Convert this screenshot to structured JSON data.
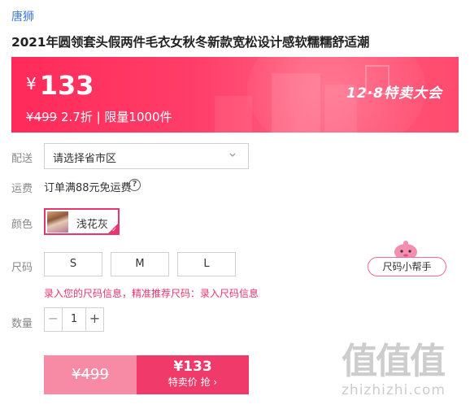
{
  "brand": "唐狮",
  "product_title": "2021年圆领套头假两件毛衣女秋冬新款宽松设计感软糯糯舒适潮",
  "banner": {
    "currency": "¥",
    "price": "133",
    "original_price": "¥499",
    "discount_info": "2.7折 | 限量1000件",
    "event_logo": "12·8特卖大会"
  },
  "shipping": {
    "label": "配送",
    "select_placeholder": "请选择省市区",
    "fee_label": "运费",
    "fee_text": "订单满88元免运费",
    "help_symbol": "?"
  },
  "color": {
    "label": "颜色",
    "selected": "浅花灰"
  },
  "size": {
    "label": "尺码",
    "options": [
      "S",
      "M",
      "L"
    ],
    "helper": "尺码小帮手",
    "tip_text": "录入您的尺码信息，精准推荐尺码：",
    "tip_link": "录入尺码信息"
  },
  "quantity": {
    "label": "数量",
    "minus": "−",
    "value": "1",
    "plus": "+"
  },
  "buy": {
    "original_price": "¥499",
    "price": "¥133",
    "action": "特卖价 抢 ›"
  },
  "watermark": {
    "big": "值值值",
    "small": "zhizhizhi.com"
  },
  "colors": {
    "accent": "#e8356d",
    "banner": "#ff3d68",
    "brand_link": "#3a7ad6"
  }
}
